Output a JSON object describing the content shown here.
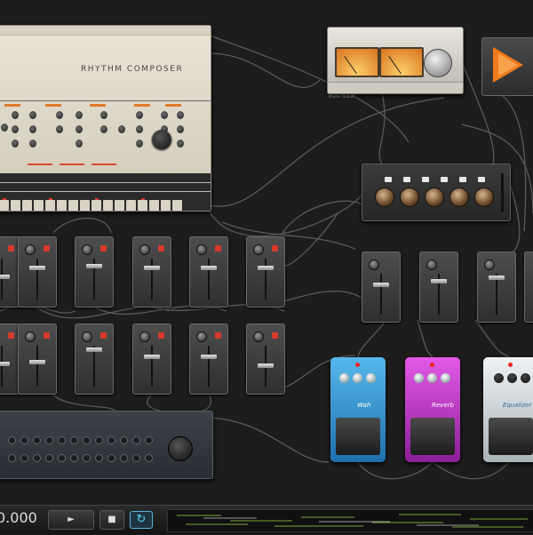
{
  "transport": {
    "tempo": "0.000",
    "play_icon": "play-icon",
    "stop_icon": "stop-icon",
    "loop_icon": "loop-icon",
    "play_glyph": "►",
    "stop_glyph": "■",
    "loop_glyph": "↻"
  },
  "drum_machine": {
    "title": "RHYTHM COMPOSER"
  },
  "pedals": {
    "blue": {
      "name": "Wah",
      "color": "#2a8fd0"
    },
    "purple": {
      "name": "Reverb",
      "color": "#c431c9"
    },
    "white": {
      "name": "Equalizer",
      "color": "#cfd6da"
    }
  },
  "vu": {
    "caption": "Master Output"
  },
  "colors": {
    "accent_orange": "#f07a1b",
    "loop_blue": "#5fd0f0",
    "cable": "#6a6a6a"
  }
}
